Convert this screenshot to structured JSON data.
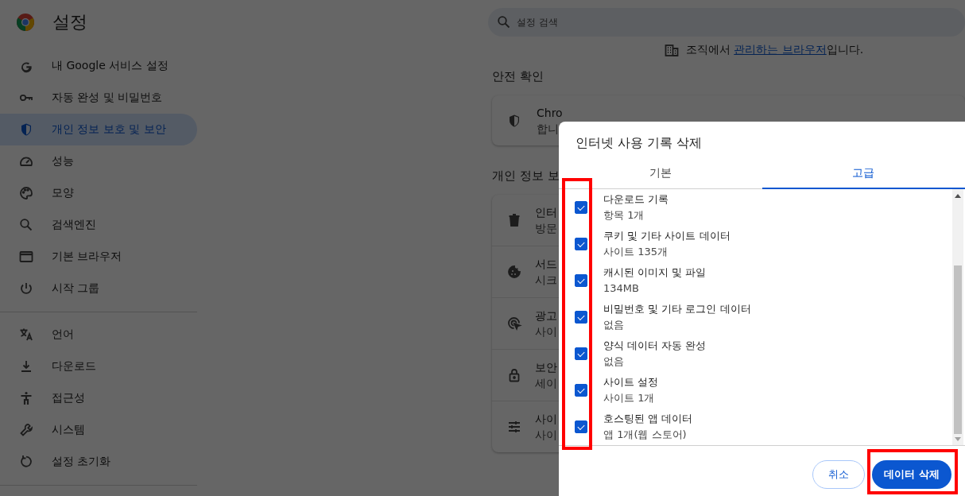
{
  "header": {
    "title": "설정"
  },
  "search": {
    "placeholder": "설정 검색"
  },
  "sidebar": {
    "groups": [
      [
        {
          "label": "내 Google 서비스 설정",
          "selected": false
        },
        {
          "label": "자동 완성 및 비밀번호",
          "selected": false
        },
        {
          "label": "개인 정보 보호 및 보안",
          "selected": true
        },
        {
          "label": "성능",
          "selected": false
        },
        {
          "label": "모양",
          "selected": false
        },
        {
          "label": "검색엔진",
          "selected": false
        },
        {
          "label": "기본 브라우저",
          "selected": false
        },
        {
          "label": "시작 그룹",
          "selected": false
        }
      ],
      [
        {
          "label": "언어",
          "selected": false
        },
        {
          "label": "다운로드",
          "selected": false
        },
        {
          "label": "접근성",
          "selected": false
        },
        {
          "label": "시스템",
          "selected": false
        },
        {
          "label": "설정 초기화",
          "selected": false
        }
      ]
    ]
  },
  "managed_notice": {
    "before": "조직에서 ",
    "link": "관리하는 브라우저",
    "after": "입니다."
  },
  "safety_check": {
    "title": "안전 확인",
    "line_1": "Chro",
    "line_2": "합니"
  },
  "privacy": {
    "title": "개인 정보 보",
    "rows": [
      {
        "line_1": "인터",
        "line_2": "방문"
      },
      {
        "line_1": "서드",
        "line_2": "시크"
      },
      {
        "line_1": "광고",
        "line_2": "사이"
      },
      {
        "line_1": "보안",
        "line_2": "세이"
      },
      {
        "line_1": "사이",
        "line_2": "사이"
      }
    ]
  },
  "dialog": {
    "title": "인터넷 사용 기록 삭제",
    "tabs": [
      {
        "label": "기본",
        "selected": false
      },
      {
        "label": "고급",
        "selected": true
      }
    ],
    "items": [
      {
        "title": "다운로드 기록",
        "detail": "항목 1개",
        "checked": true
      },
      {
        "title": "쿠키 및 기타 사이트 데이터",
        "detail": "사이트 135개",
        "checked": true
      },
      {
        "title": "캐시된 이미지 및 파일",
        "detail": "134MB",
        "checked": true
      },
      {
        "title": "비밀번호 및 기타 로그인 데이터",
        "detail": "없음",
        "checked": true
      },
      {
        "title": "양식 데이터 자동 완성",
        "detail": "없음",
        "checked": true
      },
      {
        "title": "사이트 설정",
        "detail": "사이트 1개",
        "checked": true
      },
      {
        "title": "호스팅된 앱 데이터",
        "detail": "앱 1개(웹 스토어)",
        "checked": true
      }
    ],
    "checkbox_highlight": true,
    "button_highlight": true,
    "buttons": [
      {
        "label": "취소",
        "kind": "secondary"
      },
      {
        "label": "데이터 삭제",
        "kind": "primary"
      }
    ]
  }
}
